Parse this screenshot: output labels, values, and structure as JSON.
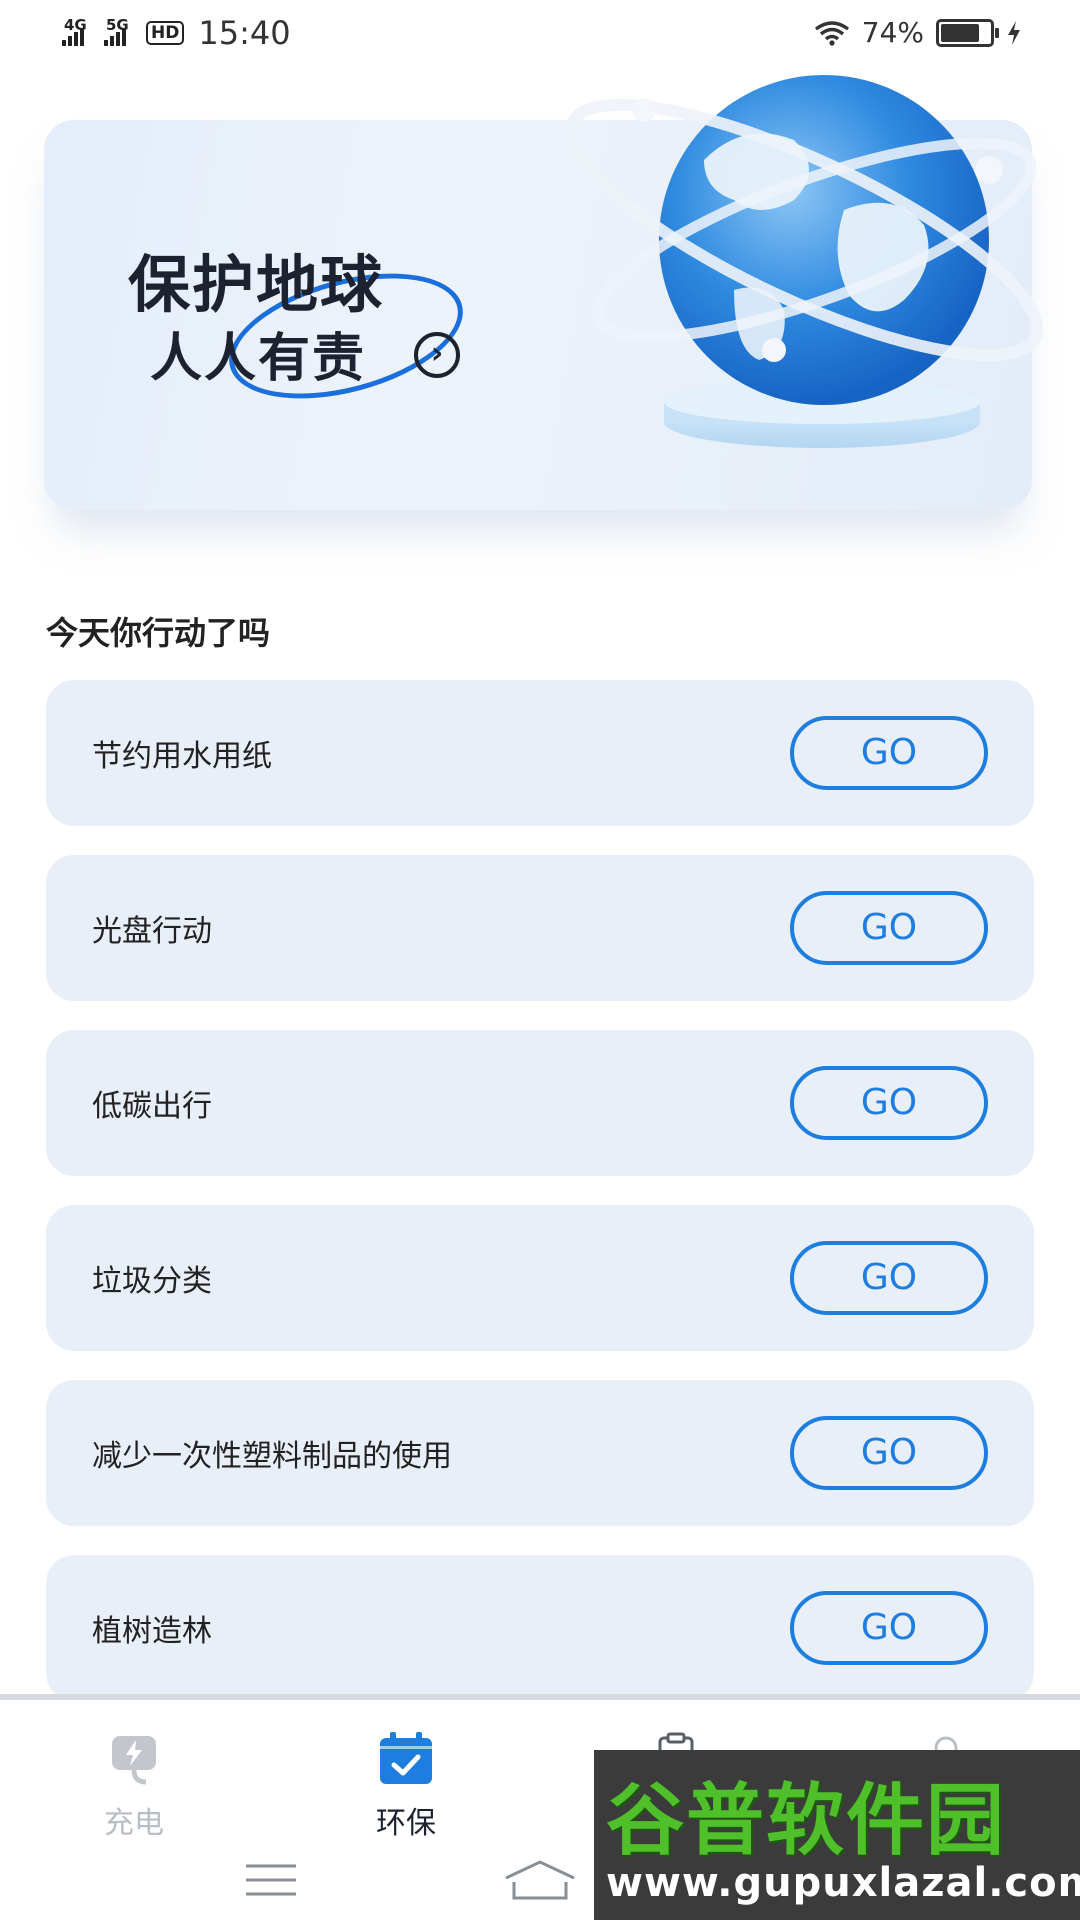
{
  "status_bar": {
    "net1": "4G",
    "net2": "5G",
    "hd": "HD",
    "time": "15:40",
    "battery_pct": "74%",
    "battery_level": 0.74
  },
  "banner": {
    "title": "保护地球",
    "subtitle": "人人有责",
    "arrow": "›"
  },
  "section_title": "今天你行动了吗",
  "actions": [
    {
      "label": "节约用水用纸",
      "button": "GO"
    },
    {
      "label": "光盘行动",
      "button": "GO"
    },
    {
      "label": "低碳出行",
      "button": "GO"
    },
    {
      "label": "垃圾分类",
      "button": "GO"
    },
    {
      "label": "减少一次性塑料制品的使用",
      "button": "GO"
    },
    {
      "label": "植树造林",
      "button": "GO"
    }
  ],
  "bottom_nav": [
    {
      "label": "充电",
      "icon": "plug-icon",
      "active": false
    },
    {
      "label": "环保",
      "icon": "calendar-check-icon",
      "active": true
    },
    {
      "label": "",
      "icon": "clipboard-icon",
      "active": false
    },
    {
      "label": "",
      "icon": "user-icon",
      "active": false
    }
  ],
  "watermark": {
    "title": "谷普软件园",
    "url": "www.gupuxlazal.com"
  },
  "colors": {
    "accent": "#1e7ee0",
    "card_bg": "#e9eff8",
    "watermark_green": "#4fbf2a"
  }
}
